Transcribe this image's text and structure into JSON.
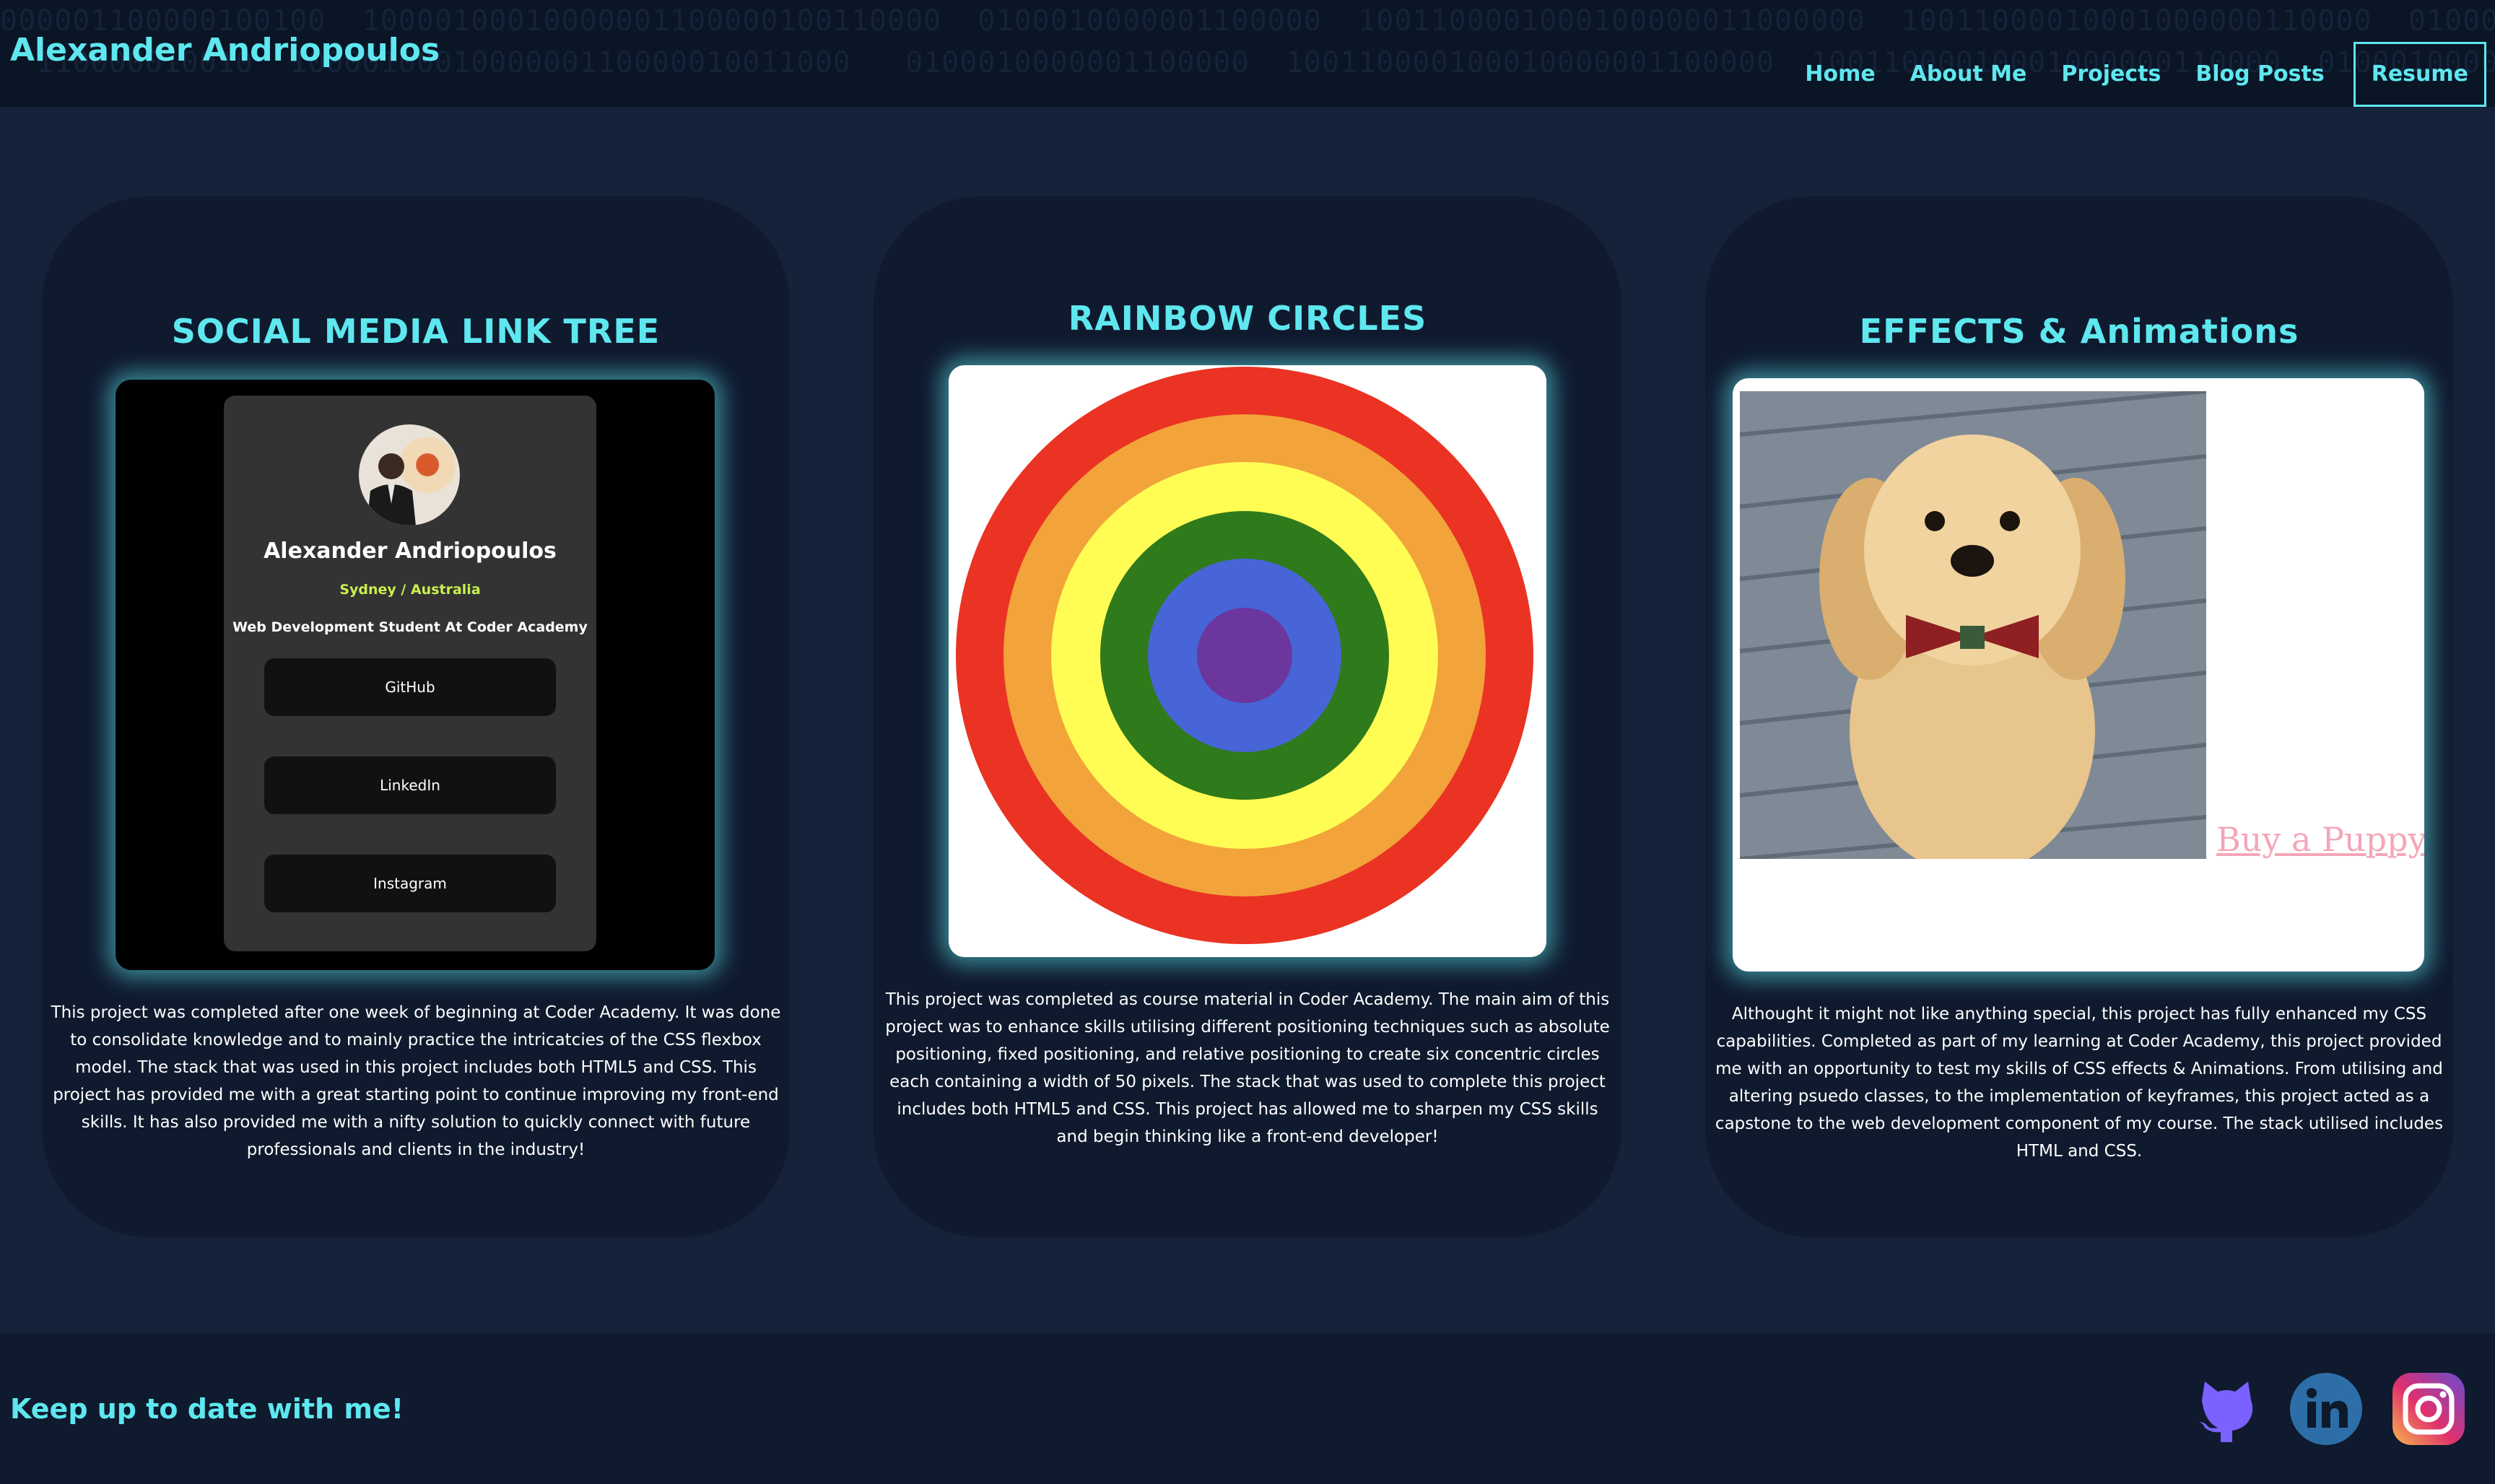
{
  "nav": {
    "brand": "Alexander Andriopoulos",
    "links": [
      "Home",
      "About Me",
      "Projects",
      "Blog Posts"
    ],
    "resume": "Resume"
  },
  "projects": [
    {
      "title": "SOCIAL MEDIA LINK TREE",
      "description": "This project was completed after one week of beginning at Coder Academy. It was done to consolidate knowledge and to mainly practice the intricatcies of the CSS flexbox model. The stack that was used in this project includes both HTML5 and CSS. This project has provided me with a great starting point to continue improving my front-end skills. It has also provided me with a nifty solution to quickly connect with future professionals and clients in the industry!",
      "preview": {
        "name": "Alexander Andriopoulos",
        "location": "Sydney / Australia",
        "role": "Web Development Student At Coder Academy",
        "buttons": [
          "GitHub",
          "LinkedIn",
          "Instagram"
        ]
      }
    },
    {
      "title": "RAINBOW CIRCLES",
      "description": "This project was completed as course material in Coder Academy. The main aim of this project was to enhance skills utilising different positioning techniques such as absolute positioning, fixed positioning, and relative positioning to create six concentric circles each containing a width of 50 pixels. The stack that was used to complete this project includes both HTML5 and CSS. This project has allowed me to sharpen my CSS skills and begin thinking like a front-end developer!",
      "rings": [
        "#ea3323",
        "#f2a33a",
        "#fffc54",
        "#2f7a1b",
        "#4765d6",
        "#6b369e"
      ]
    },
    {
      "title": "EFFECTS & Animations",
      "description": "Althought it might not like anything special, this project has fully enhanced my CSS capabilities. Completed as part of my learning at Coder Academy, this project provided me with an opportunity to test my skills of CSS effects & Animations. From utilising and altering psuedo classes, to the implementation of keyframes, this project acted as a capstone to the web development component of my course. The stack utilised includes HTML and CSS.",
      "link": "Buy a Puppy"
    }
  ],
  "footer": {
    "text": "Keep up to date with me!",
    "icons": [
      "github-icon",
      "linkedin-icon",
      "instagram-icon"
    ]
  },
  "colors": {
    "accent": "#5ee7ef",
    "background": "#16223a",
    "card": "#0f1a2e"
  }
}
